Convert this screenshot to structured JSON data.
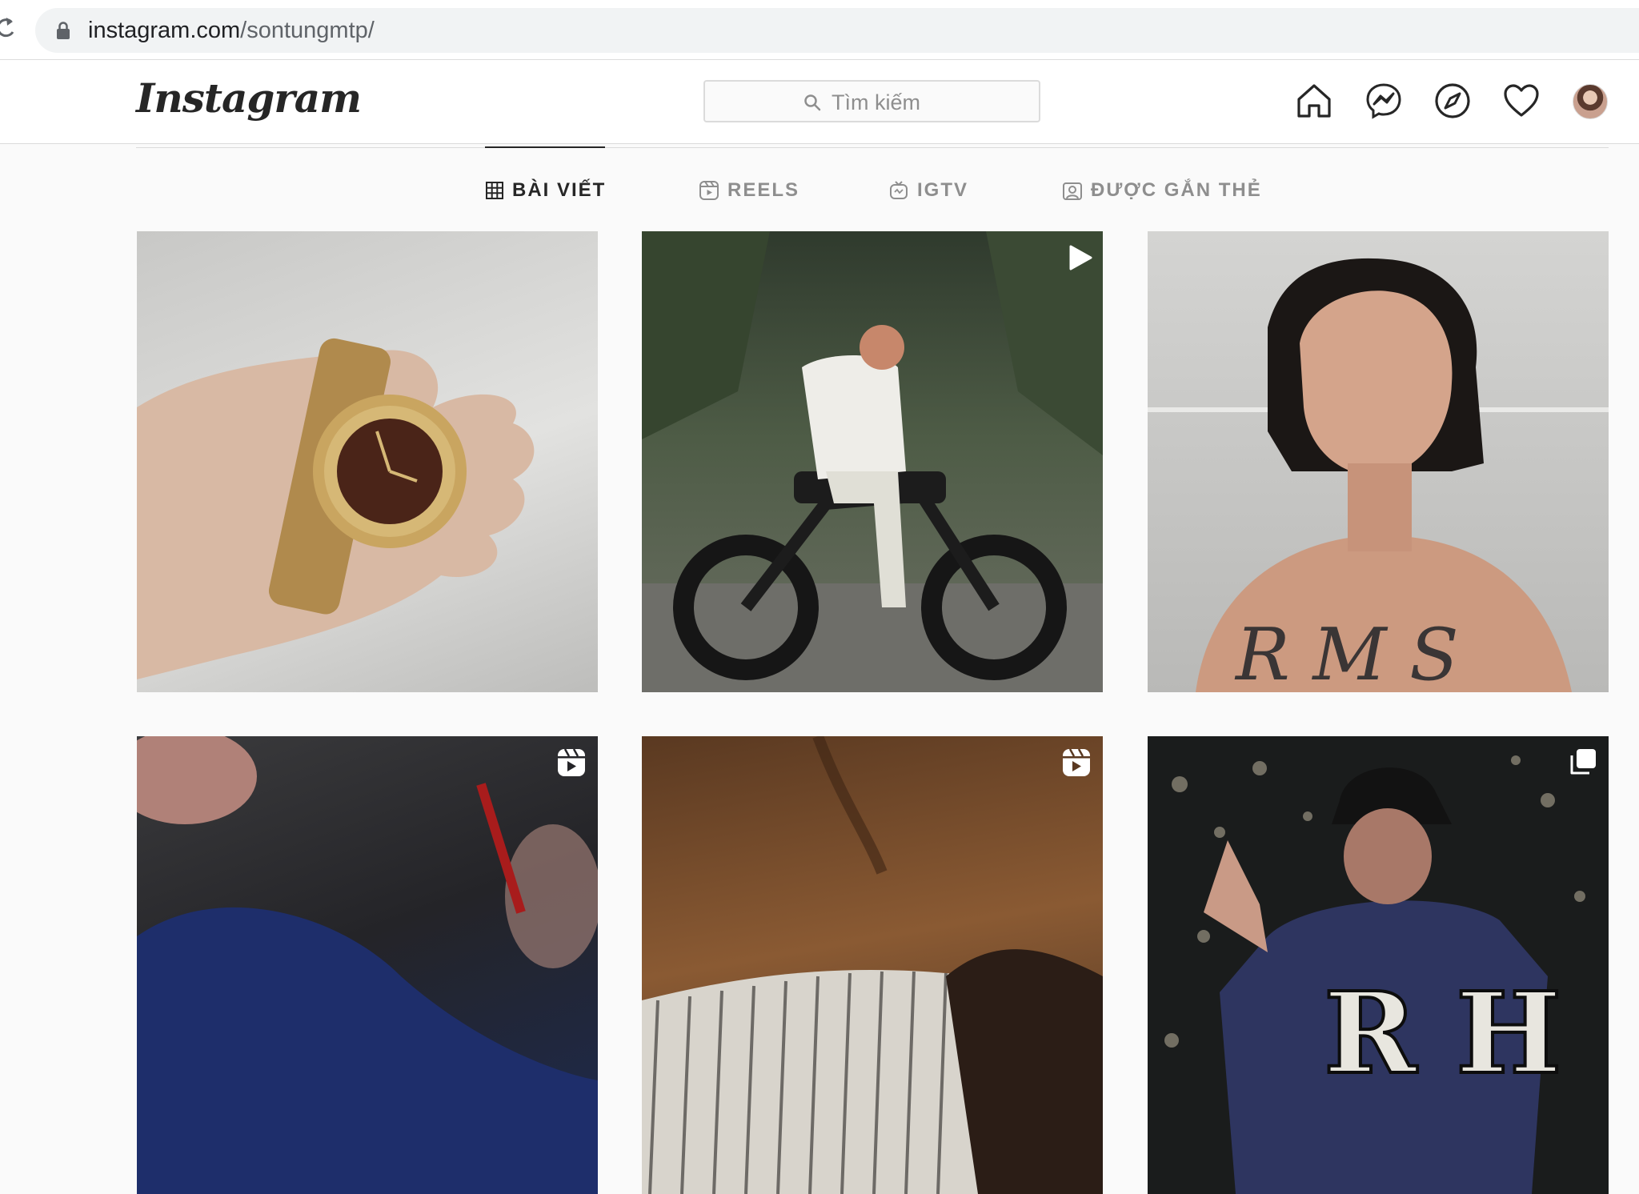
{
  "browser": {
    "url_domain": "instagram.com",
    "url_path": "/sontungmtp/"
  },
  "nav": {
    "logo_text": "Instagram",
    "search_placeholder": "Tìm kiếm",
    "icons": [
      "home-icon",
      "messenger-icon",
      "explore-compass-icon",
      "activity-heart-icon"
    ]
  },
  "tabs": [
    {
      "label": "BÀI VIẾT",
      "icon": "grid-icon",
      "active": true
    },
    {
      "label": "REELS",
      "icon": "reels-icon",
      "active": false
    },
    {
      "label": "IGTV",
      "icon": "igtv-icon",
      "active": false
    },
    {
      "label": "ĐƯỢC GẮN THẺ",
      "icon": "tagged-icon",
      "active": false
    }
  ],
  "posts": [
    {
      "subject": "gold watch held in hand",
      "badge": null
    },
    {
      "subject": "man on motorbike among plants",
      "badge": "video-play-icon"
    },
    {
      "subject": "shirtless selfie portrait",
      "badge": null
    },
    {
      "subject": "blurred person in blue",
      "badge": "reel-icon"
    },
    {
      "subject": "leather sofa and striped shirt",
      "badge": "reel-icon"
    },
    {
      "subject": "performer in navy RH sweatshirt",
      "badge": "carousel-icon"
    }
  ],
  "colors": {
    "primary_text": "#262626",
    "secondary_text": "#8e8e8e",
    "border": "#dbdbdb",
    "background": "#fafafa"
  }
}
